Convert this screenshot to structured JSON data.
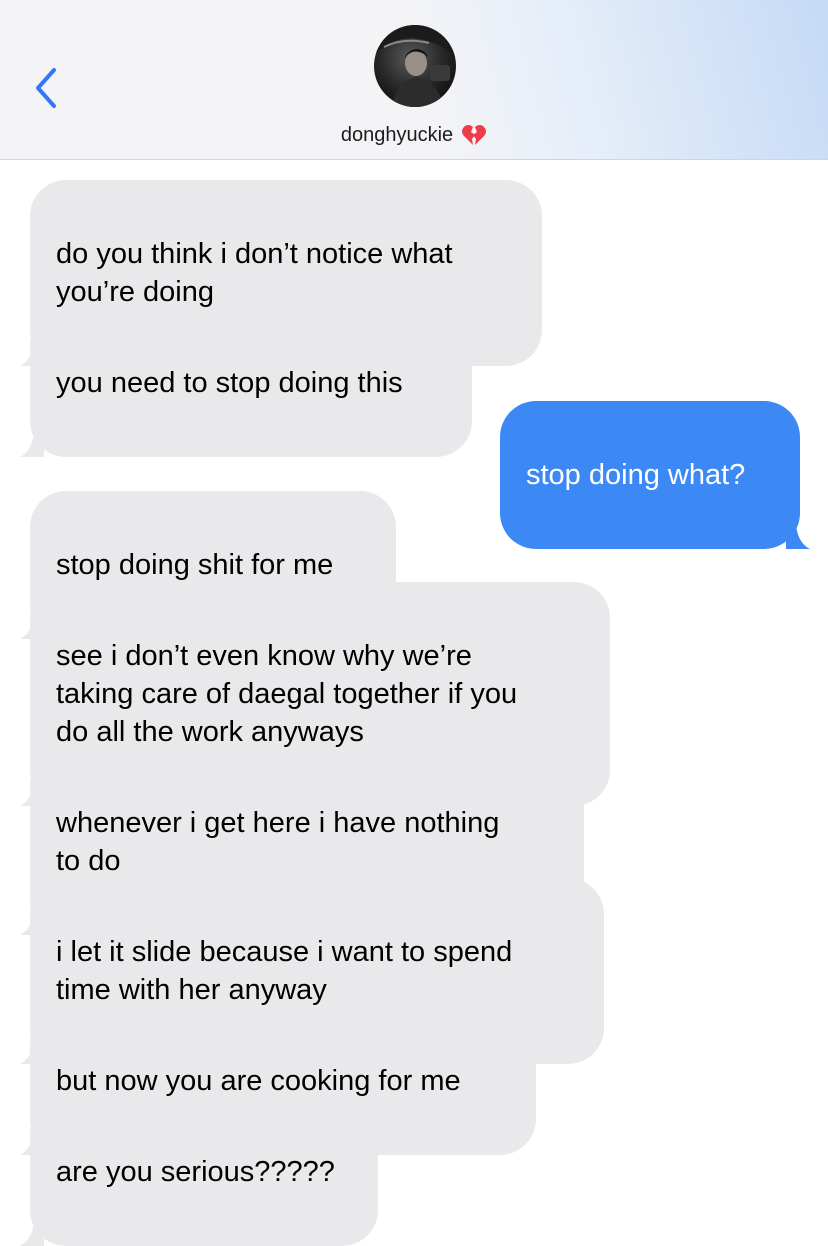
{
  "header": {
    "contact_name": "donghyuckie",
    "heart_emoji": "💔",
    "accent_color": "#3478f6"
  },
  "messages": [
    {
      "direction": "incoming",
      "text": "do you think i don’t notice what\nyou’re doing"
    },
    {
      "direction": "incoming",
      "text": "you need to stop doing this"
    },
    {
      "direction": "outgoing",
      "text": "stop doing what?"
    },
    {
      "direction": "incoming",
      "text": "stop doing shit for me"
    },
    {
      "direction": "incoming",
      "text": "see i don’t even know why we’re\ntaking care of daegal together if you\ndo all the work anyways"
    },
    {
      "direction": "incoming",
      "text": "whenever i get here i have nothing\nto do"
    },
    {
      "direction": "incoming",
      "text": "i let it slide because i want to spend\ntime with her anyway"
    },
    {
      "direction": "incoming",
      "text": "but now you are cooking for me"
    },
    {
      "direction": "incoming",
      "text": "are you serious?????"
    }
  ],
  "colors": {
    "incoming_bubble": "#e9e9eb",
    "outgoing_bubble": "#3c89f5",
    "header_bg": "#f4f4f6"
  }
}
